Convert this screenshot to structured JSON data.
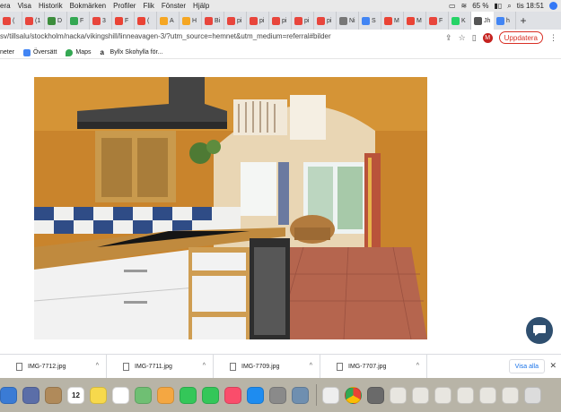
{
  "menubar": {
    "items": [
      "era",
      "Visa",
      "Historik",
      "Bokmärken",
      "Profiler",
      "Flik",
      "Fönster",
      "Hjälp"
    ],
    "battery": "65 %",
    "clock": "tis 18:51"
  },
  "tabs": [
    {
      "label": "(",
      "color": "#e8453c"
    },
    {
      "label": "(1",
      "color": "#e8453c"
    },
    {
      "label": "D",
      "color": "#3c8d3c"
    },
    {
      "label": "F",
      "color": "#34a853"
    },
    {
      "label": "3",
      "color": "#e8453c"
    },
    {
      "label": "F",
      "color": "#ea4335"
    },
    {
      "label": "(",
      "color": "#ea4335"
    },
    {
      "label": "A",
      "color": "#f5a623"
    },
    {
      "label": "H",
      "color": "#f5a623"
    },
    {
      "label": "Bi",
      "color": "#e8453c"
    },
    {
      "label": "pi",
      "color": "#e8453c"
    },
    {
      "label": "pi",
      "color": "#e8453c"
    },
    {
      "label": "pi",
      "color": "#e8453c"
    },
    {
      "label": "pi",
      "color": "#e8453c"
    },
    {
      "label": "pi",
      "color": "#e8453c"
    },
    {
      "label": "Ni",
      "color": "#777777"
    },
    {
      "label": "S",
      "color": "#4285f4"
    },
    {
      "label": "M",
      "color": "#ea4335"
    },
    {
      "label": "M",
      "color": "#ea4335"
    },
    {
      "label": "F",
      "color": "#e8453c"
    },
    {
      "label": "K",
      "color": "#25d366"
    },
    {
      "label": "Jh",
      "color": "#555555"
    },
    {
      "label": "h",
      "color": "#4285f4"
    }
  ],
  "address": {
    "url": "sv/tillsalu/stockholm/nacka/vikingshill/linneavagen-3/?utm_source=hemnet&utm_medium=referral#bilder",
    "avatar": "M",
    "update_label": "Uppdatera"
  },
  "bookmarks": [
    {
      "label": "neter",
      "color": "#ffffff"
    },
    {
      "label": "Översätt",
      "color": "#4285f4"
    },
    {
      "label": "Maps",
      "color": "#34a853"
    },
    {
      "label": "Byllx Skohylla för...",
      "color": "#222222"
    }
  ],
  "downloads": {
    "files": [
      "IMG-7712.jpg",
      "IMG-7711.jpg",
      "IMG-7709.jpg",
      "IMG-7707.jpg"
    ],
    "show_all": "Visa alla"
  },
  "dock": {
    "calendar_day": "12",
    "icons": [
      {
        "name": "finder",
        "color": "#3a7bd5"
      },
      {
        "name": "mail-stamp",
        "color": "#5b6ea8"
      },
      {
        "name": "contacts",
        "color": "#b08a5a"
      },
      {
        "name": "calendar",
        "color": "#ffffff"
      },
      {
        "name": "notes",
        "color": "#f7d94c"
      },
      {
        "name": "reminders",
        "color": "#ffffff"
      },
      {
        "name": "maps",
        "color": "#6fbf73"
      },
      {
        "name": "photos",
        "color": "#f4a742"
      },
      {
        "name": "facetime",
        "color": "#34c759"
      },
      {
        "name": "messages",
        "color": "#34c759"
      },
      {
        "name": "music",
        "color": "#fa4d6b"
      },
      {
        "name": "app-store",
        "color": "#1e8cf0"
      },
      {
        "name": "system-preferences",
        "color": "#8a8a8a"
      },
      {
        "name": "preview",
        "color": "#6f8fb0"
      },
      {
        "name": "finder-window",
        "color": "#eeeeee"
      },
      {
        "name": "chrome",
        "color": "#ffffff"
      },
      {
        "name": "printer",
        "color": "#6a6a6a"
      },
      {
        "name": "window-1",
        "color": "#e8e6e0"
      },
      {
        "name": "window-2",
        "color": "#e8e6e0"
      },
      {
        "name": "window-3",
        "color": "#e8e6e0"
      },
      {
        "name": "window-4",
        "color": "#e8e6e0"
      },
      {
        "name": "window-5",
        "color": "#e8e6e0"
      },
      {
        "name": "window-6",
        "color": "#e8e6e0"
      },
      {
        "name": "trash",
        "color": "#dcdcdc"
      }
    ]
  }
}
